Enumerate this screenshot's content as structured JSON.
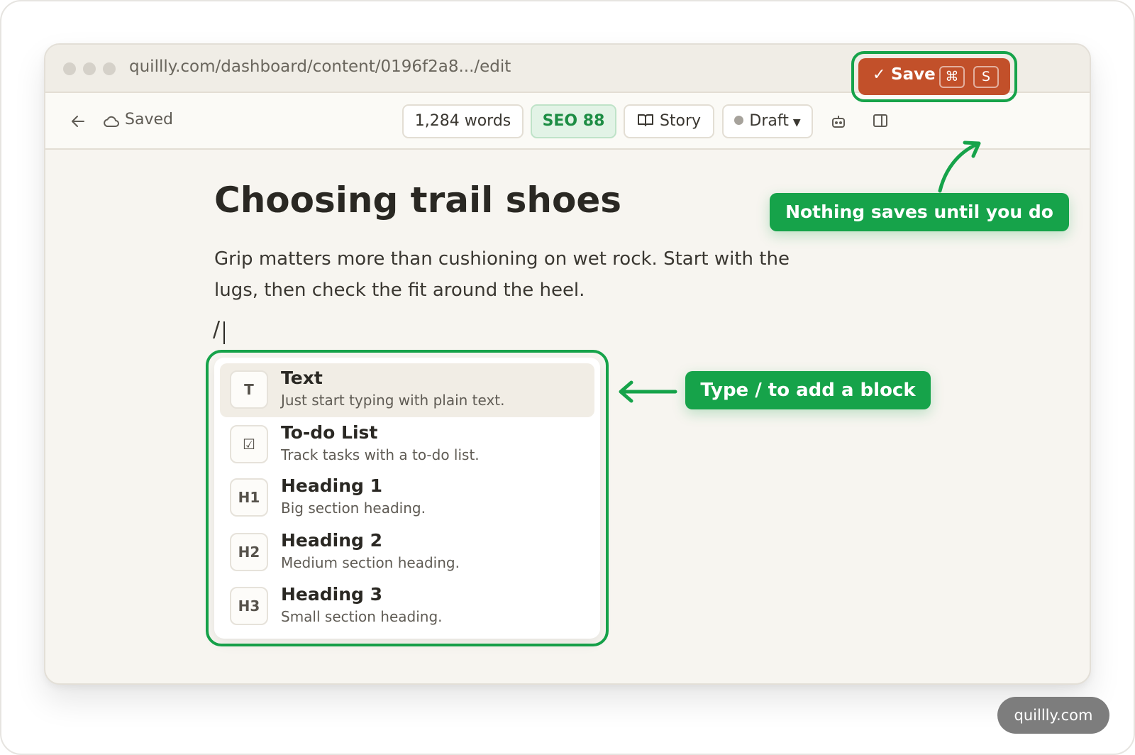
{
  "browser": {
    "url": "quillly.com/dashboard/content/0196f2a8.../edit"
  },
  "toolbar": {
    "saved_label": "Saved",
    "word_count": "1,284 words",
    "seo": "SEO 88",
    "story_label": "Story",
    "status_label": "Draft",
    "save_label": "Save",
    "save_check": "✓",
    "shortcut_cmd": "⌘",
    "shortcut_key": "S",
    "colors": {
      "save": "#c2502a",
      "seo_text": "#1d8d44",
      "seo_bg": "#e2f3e6"
    }
  },
  "document": {
    "title": "Choosing trail shoes",
    "paragraph": "Grip matters more than cushioning on wet rock. Start with the lugs, then check the fit around the heel.",
    "slash_input": "/"
  },
  "block_menu": {
    "items": [
      {
        "badge": "T",
        "title": "Text",
        "description": "Just start typing with plain text.",
        "active": true
      },
      {
        "badge": "☑",
        "title": "To-do List",
        "description": "Track tasks with a to-do list."
      },
      {
        "badge": "H1",
        "title": "Heading 1",
        "description": "Big section heading."
      },
      {
        "badge": "H2",
        "title": "Heading 2",
        "description": "Medium section heading."
      },
      {
        "badge": "H3",
        "title": "Heading 3",
        "description": "Small section heading."
      }
    ]
  },
  "annotations": {
    "save_note": "Nothing saves until you do",
    "block_note": "Type / to add a block",
    "color": "#16a34a"
  },
  "watermark": "quillly.com",
  "icons": [
    "back-arrow-icon",
    "cloud-icon",
    "book-icon",
    "bot-icon",
    "split-view-icon",
    "checkmark-icon"
  ]
}
